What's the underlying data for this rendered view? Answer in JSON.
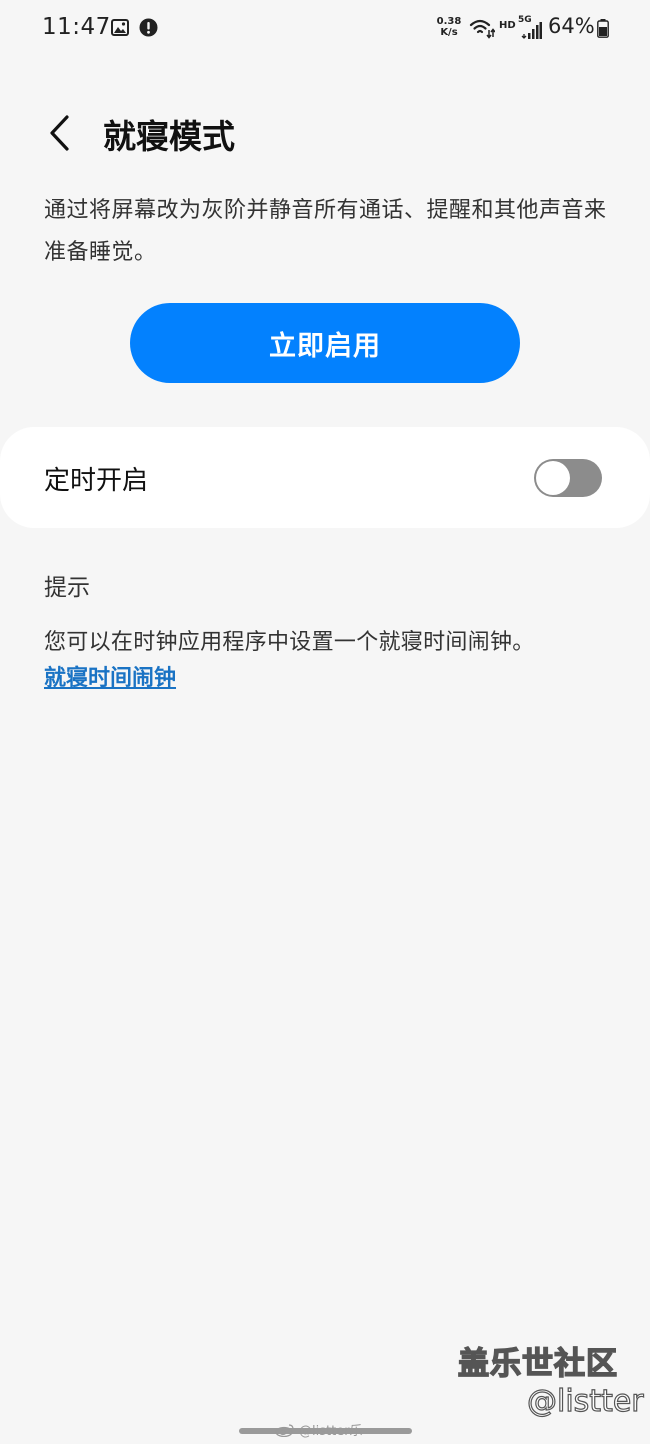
{
  "status_bar": {
    "time": "11:47",
    "speed_value": "0.38",
    "speed_unit": "K/s",
    "hd": "HD",
    "network": "5G",
    "battery_percent": "64%",
    "icons": [
      "gallery-icon",
      "alert-icon",
      "wifi-icon",
      "signal-icon",
      "battery-icon"
    ]
  },
  "header": {
    "title": "就寝模式",
    "back_icon": "chevron-left-icon"
  },
  "description": "通过将屏幕改为灰阶并静音所有通话、提醒和其他声音来准备睡觉。",
  "primary_button": {
    "label": "立即启用",
    "color": "#0381fe"
  },
  "schedule": {
    "label": "定时开启",
    "enabled": false
  },
  "tips": {
    "header": "提示",
    "text": "您可以在时钟应用程序中设置一个就寝时间闹钟。",
    "link_label": "就寝时间闹钟",
    "link_color": "#1a73c4"
  },
  "watermark": {
    "community": "盖乐世社区",
    "handle": "@listter",
    "weibo": "@listter乐"
  }
}
